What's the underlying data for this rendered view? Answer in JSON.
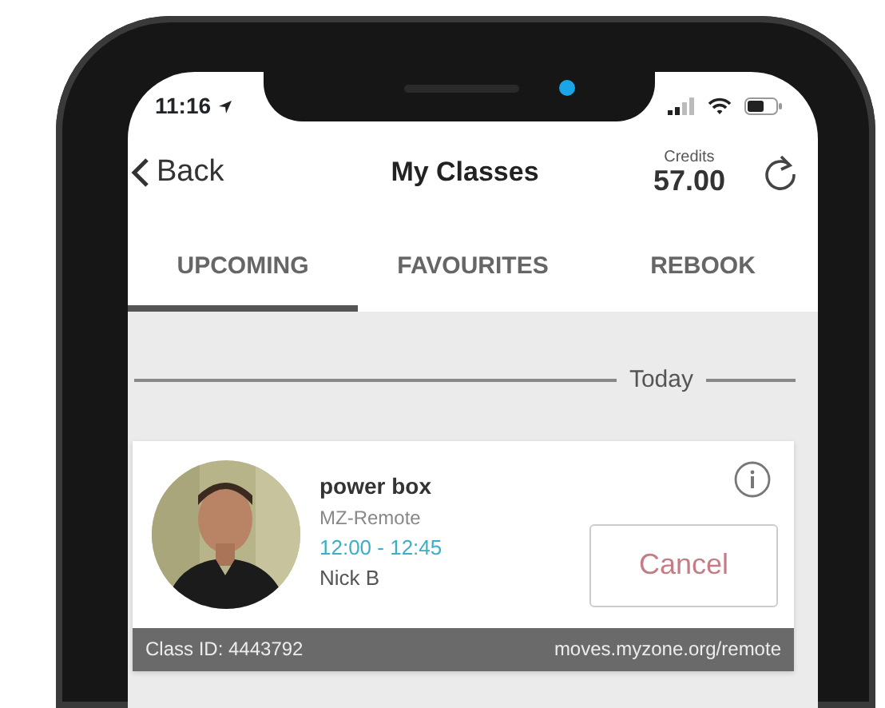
{
  "status_bar": {
    "time": "11:16"
  },
  "nav": {
    "back": "Back",
    "title": "My Classes",
    "credits_label": "Credits",
    "credits": "57.00"
  },
  "tabs": [
    {
      "label": "UPCOMING",
      "selected": true
    },
    {
      "label": "FAVOURITES",
      "selected": false
    },
    {
      "label": "REBOOK",
      "selected": false
    }
  ],
  "section": "Today",
  "classes": [
    {
      "name": "power box",
      "location": "MZ-Remote",
      "time": "12:00 - 12:45",
      "instructor": "Nick B",
      "action": "Cancel",
      "class_id": "Class ID: 4443792",
      "link": "moves.myzone.org/remote"
    }
  ]
}
